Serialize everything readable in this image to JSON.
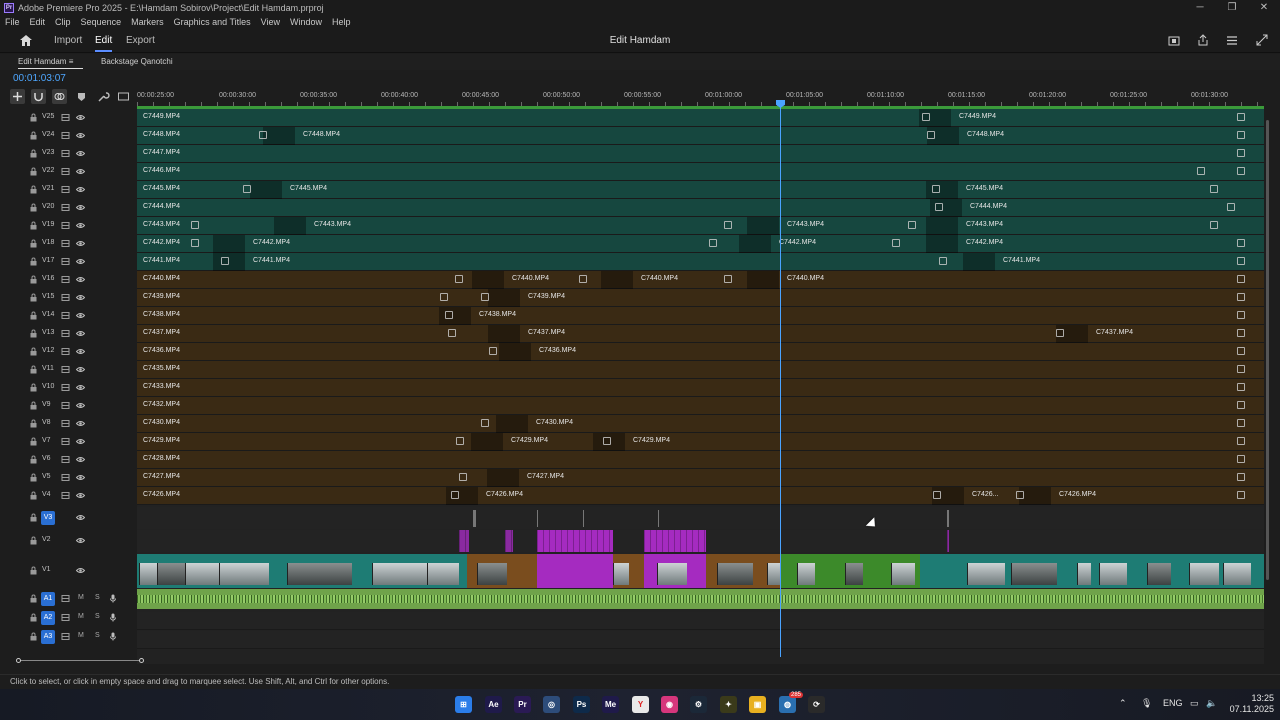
{
  "window": {
    "title": "Adobe Premiere Pro 2025 - E:\\Hamdam Sobirov\\Project\\Edit Hamdam.prproj",
    "controls": [
      "─",
      "❐",
      "✕"
    ]
  },
  "menu": [
    "File",
    "Edit",
    "Clip",
    "Sequence",
    "Markers",
    "Graphics and Titles",
    "View",
    "Window",
    "Help"
  ],
  "header": {
    "import_label": "Import",
    "edit_label": "Edit",
    "export_label": "Export",
    "project_name": "Edit Hamdam"
  },
  "panel": {
    "active_tab": "Edit Hamdam",
    "tab_menu_glyph": "≡",
    "second_tab": "Backstage Qanotchi",
    "timecode": "00:01:03:07"
  },
  "ruler": {
    "labels": [
      "00:00:25:00",
      "00:00:30:00",
      "00:00:35:00",
      "00:00:40:00",
      "00:00:45:00",
      "00:00:50:00",
      "00:00:55:00",
      "00:01:00:00",
      "00:01:05:00",
      "00:01:10:00",
      "00:01:15:00",
      "00:01:20:00",
      "00:01:25:00",
      "00:01:30:00"
    ]
  },
  "video_tracks": [
    {
      "name": "V25",
      "clips": [
        "C7449.MP4",
        "C7449.MP4"
      ]
    },
    {
      "name": "V24",
      "clips": [
        "C7448.MP4",
        "C7448.MP4",
        "C7448.MP4"
      ]
    },
    {
      "name": "V23",
      "clips": [
        "C7447.MP4"
      ]
    },
    {
      "name": "V22",
      "clips": [
        "C7446.MP4"
      ]
    },
    {
      "name": "V21",
      "clips": [
        "C7445.MP4",
        "C7445.MP4",
        "C7445.MP4"
      ]
    },
    {
      "name": "V20",
      "clips": [
        "C7444.MP4",
        "C7444.MP4"
      ]
    },
    {
      "name": "V19",
      "clips": [
        "C7443.MP4",
        "C7443.MP4",
        "C7443.MP4",
        "C7443.MP4"
      ]
    },
    {
      "name": "V18",
      "clips": [
        "C7442.MP4",
        "C7442.MP4",
        "C7442.MP4",
        "C7442.MP4"
      ]
    },
    {
      "name": "V17",
      "clips": [
        "C7441.MP4",
        "C7441.MP4",
        "C7441.MP4"
      ]
    },
    {
      "name": "V16",
      "clips": [
        "C7440.MP4",
        "C7440.MP4",
        "C7440.MP4",
        "C7440.MP4"
      ]
    },
    {
      "name": "V15",
      "clips": [
        "C7439.MP4",
        "C7439.MP4"
      ]
    },
    {
      "name": "V14",
      "clips": [
        "C7438.MP4",
        "C7438.MP4"
      ]
    },
    {
      "name": "V13",
      "clips": [
        "C7437.MP4",
        "C7437.MP4",
        "C7437.MP4"
      ]
    },
    {
      "name": "V12",
      "clips": [
        "C7436.MP4",
        "C7436.MP4"
      ]
    },
    {
      "name": "V11",
      "clips": [
        "C7435.MP4"
      ]
    },
    {
      "name": "V10",
      "clips": [
        "C7433.MP4"
      ]
    },
    {
      "name": "V9",
      "clips": [
        "C7432.MP4"
      ]
    },
    {
      "name": "V8",
      "clips": [
        "C7430.MP4",
        "C7430.MP4"
      ]
    },
    {
      "name": "V7",
      "clips": [
        "C7429.MP4",
        "C7429.MP4",
        "C7429.MP4"
      ]
    },
    {
      "name": "V6",
      "clips": [
        "C7428.MP4"
      ]
    },
    {
      "name": "V5",
      "clips": [
        "C7427.MP4",
        "C7427.MP4"
      ]
    },
    {
      "name": "V4",
      "clips": [
        "C7426.MP4",
        "C7426.MP4",
        "C7426...",
        "C7426.MP4"
      ]
    }
  ],
  "lower_tracks": {
    "v3": "V3",
    "v2": "V2",
    "v1": "V1"
  },
  "audio_tracks": [
    {
      "name": "A1",
      "m": "M",
      "s": "S"
    },
    {
      "name": "A2",
      "m": "M",
      "s": "S"
    },
    {
      "name": "A3",
      "m": "M",
      "s": "S"
    }
  ],
  "playhead": {
    "time": "00:01:03:07"
  },
  "status": "Click to select, or click in empty space and drag to marquee select. Use Shift, Alt, and Ctrl for other options.",
  "taskbar": {
    "apps": [
      {
        "name": "windows-start-icon",
        "glyph": "⊞",
        "color": "#2b7de9"
      },
      {
        "name": "after-effects-icon",
        "glyph": "Ae",
        "color": "#1f1a4a"
      },
      {
        "name": "premiere-icon",
        "glyph": "Pr",
        "color": "#2a1a54"
      },
      {
        "name": "pinned-app-icon",
        "glyph": "◎",
        "color": "#2d4c7a"
      },
      {
        "name": "photoshop-icon",
        "glyph": "Ps",
        "color": "#0e2a4a"
      },
      {
        "name": "media-encoder-icon",
        "glyph": "Me",
        "color": "#1f1a4a"
      },
      {
        "name": "yandex-browser-icon",
        "glyph": "Y",
        "color": "#e9e9e9"
      },
      {
        "name": "instagram-icon",
        "glyph": "◉",
        "color": "#d6367c"
      },
      {
        "name": "steam-icon",
        "glyph": "⚙",
        "color": "#1b2838"
      },
      {
        "name": "pinned-app-2-icon",
        "glyph": "✦",
        "color": "#3a3a1a"
      },
      {
        "name": "file-explorer-icon",
        "glyph": "▣",
        "color": "#e8b020"
      },
      {
        "name": "browser-icon",
        "glyph": "◍",
        "color": "#2a6fb0"
      },
      {
        "name": "media-player-icon",
        "glyph": "⟳",
        "color": "#2a2a2a"
      }
    ],
    "badge": "285",
    "language": "ENG",
    "time": "13:25",
    "date": "07.11.2025"
  }
}
